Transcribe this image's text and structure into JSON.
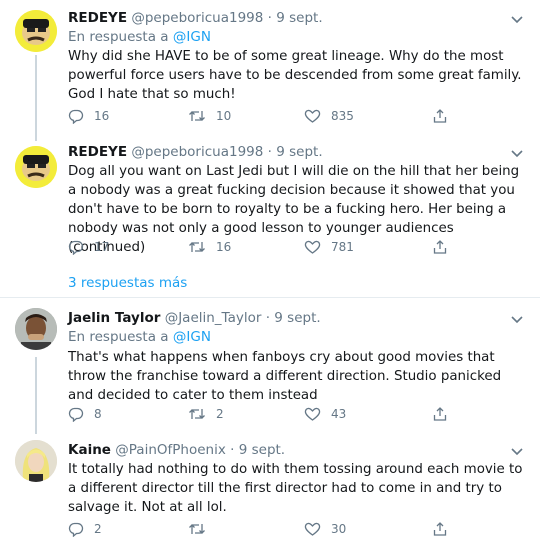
{
  "tweets": [
    {
      "name": "REDEYE",
      "handle": "@pepeboricua1998",
      "dot": "·",
      "date": "9 sept.",
      "reply_prefix": "En respuesta a",
      "reply_mention": "@IGN",
      "text": "Why did she HAVE to be of some great lineage. Why do the most powerful force users have to be descended from some great family. God I hate that so much!",
      "replies": "16",
      "retweets": "10",
      "likes": "835"
    },
    {
      "name": "REDEYE",
      "handle": "@pepeboricua1998",
      "dot": "·",
      "date": "9 sept.",
      "text": "Dog all you want on Last Jedi but I will die on the hill that her being a nobody was a great fucking decision because it showed that you don't have to be born to royalty to be a fucking hero. Her being a nobody was not only a good lesson to younger audiences (continued)",
      "replies": "17",
      "retweets": "16",
      "likes": "781"
    },
    {
      "name": "Jaelin Taylor",
      "handle": "@Jaelin_Taylor",
      "dot": "·",
      "date": "9 sept.",
      "reply_prefix": "En respuesta a",
      "reply_mention": "@IGN",
      "text": "That's what happens when fanboys cry about good movies that throw the franchise toward a different direction. Studio panicked and decided to cater to them instead",
      "replies": "8",
      "retweets": "2",
      "likes": "43"
    },
    {
      "name": "Kaine",
      "handle": "@PainOfPhoenix",
      "dot": "·",
      "date": "9 sept.",
      "text": "It totally had nothing to do with them tossing around each movie to a different director till the first director had to come in and try to salvage it. Not at all lol.",
      "replies": "2",
      "retweets": "",
      "likes": "30"
    }
  ],
  "more_replies": "3 respuestas más",
  "icons": {
    "reply": "reply-icon",
    "retweet": "retweet-icon",
    "like": "heart-icon",
    "share": "share-icon",
    "caret": "chevron-down-icon"
  },
  "colors": {
    "accent": "#1da1f2",
    "secondary_text": "#657786",
    "primary_text": "#14171a",
    "divider": "#e6ecf0",
    "thread_line": "#ccd6dd"
  }
}
